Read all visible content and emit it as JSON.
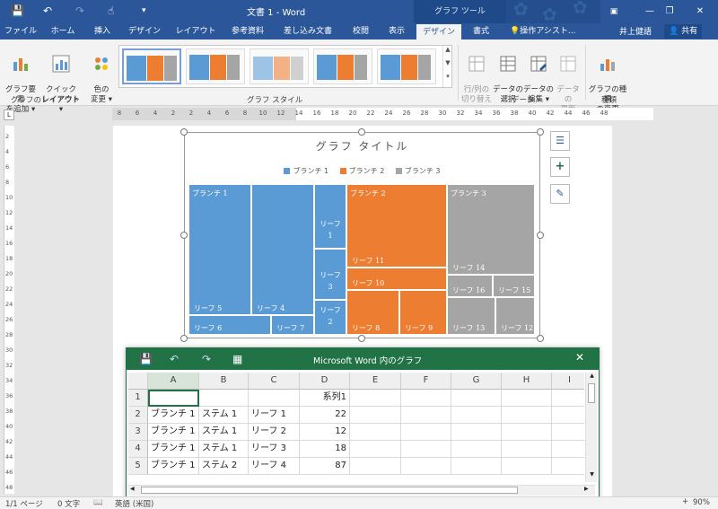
{
  "window": {
    "title": "文書 1 - Word",
    "context_tab_group": "グラフ ツール",
    "minimize": "—",
    "restore": "❐",
    "close": "✕",
    "ribbon_options": "▣"
  },
  "quick_access": {
    "save": "💾",
    "undo": "↶",
    "redo": "↷",
    "touch": "☝",
    "customize": "▾"
  },
  "tabs": [
    {
      "label": "ファイル",
      "active": false
    },
    {
      "label": "ホーム",
      "active": false
    },
    {
      "label": "挿入",
      "active": false
    },
    {
      "label": "デザイン",
      "active": false
    },
    {
      "label": "レイアウト",
      "active": false
    },
    {
      "label": "参考資料",
      "active": false
    },
    {
      "label": "差し込み文書",
      "active": false
    },
    {
      "label": "校閲",
      "active": false
    },
    {
      "label": "表示",
      "active": false
    },
    {
      "label": "デザイン",
      "active": true
    },
    {
      "label": "書式",
      "active": false
    }
  ],
  "tell_me": "操作アシスト...",
  "user": "井上健語",
  "share": "共有",
  "ribbon": {
    "add_element": "グラフ要素\nを追加 ▾",
    "quick_layout": "クイック\nレイアウト ▾",
    "change_colors": "色の\n変更 ▾",
    "switch_row_col": "行/列の\n切り替え",
    "select_data": "データの\n選択",
    "edit_data": "データの\n編集 ▾",
    "refresh_data": "データの\n更新",
    "change_type": "グラフの種類\nの変更",
    "group_layout": "グラフのレイアウト",
    "group_styles": "グラフ スタイル",
    "group_data": "データ",
    "group_type": "種類"
  },
  "ruler": {
    "corner": "L",
    "labels": [
      "8",
      "6",
      "4",
      "2",
      "2",
      "4",
      "6",
      "8",
      "10",
      "12",
      "14",
      "16",
      "18",
      "20",
      "22",
      "24",
      "26",
      "28",
      "30",
      "32",
      "34",
      "36",
      "38",
      "40",
      "42",
      "44",
      "46",
      "48"
    ],
    "vlabels": [
      "2",
      "4",
      "6",
      "8",
      "10",
      "12",
      "14",
      "16",
      "18",
      "20",
      "22",
      "24",
      "26",
      "28",
      "30",
      "32",
      "34",
      "36",
      "38",
      "40",
      "42",
      "44",
      "46",
      "48"
    ]
  },
  "chart_data": {
    "type": "treemap",
    "title": "グラフ タイトル",
    "legend": [
      "ブランチ 1",
      "ブランチ 2",
      "ブランチ 3"
    ],
    "colors": {
      "ブランチ 1": "#5b9bd5",
      "ブランチ 2": "#ed7d31",
      "ブランチ 3": "#a5a5a5"
    },
    "legend_position": "top",
    "series_name": "系列1",
    "categories": [
      "ブランチ",
      "ステム",
      "リーフ"
    ],
    "data": [
      {
        "branch": "ブランチ 1",
        "stem": "ステム 1",
        "leaf": "リーフ 1",
        "value": 22
      },
      {
        "branch": "ブランチ 1",
        "stem": "ステム 1",
        "leaf": "リーフ 2",
        "value": 12
      },
      {
        "branch": "ブランチ 1",
        "stem": "ステム 1",
        "leaf": "リーフ 3",
        "value": 18
      },
      {
        "branch": "ブランチ 1",
        "stem": "ステム 2",
        "leaf": "リーフ 4",
        "value": 87
      },
      {
        "branch": "ブランチ 1",
        "stem": "ステム 2",
        "leaf": "リーフ 5",
        "value": 88
      },
      {
        "branch": "ブランチ 1",
        "stem": "ステム 2",
        "leaf": "リーフ 6",
        "value": 25
      },
      {
        "branch": "ブランチ 1",
        "stem": "ステム 2",
        "leaf": "リーフ 7",
        "value": 15
      },
      {
        "branch": "ブランチ 2",
        "stem": "",
        "leaf": "リーフ 8",
        "value": 24
      },
      {
        "branch": "ブランチ 2",
        "stem": "",
        "leaf": "リーフ 9",
        "value": 22
      },
      {
        "branch": "ブランチ 2",
        "stem": "",
        "leaf": "リーフ 10",
        "value": 25
      },
      {
        "branch": "ブランチ 2",
        "stem": "",
        "leaf": "リーフ 11",
        "value": 82
      },
      {
        "branch": "ブランチ 3",
        "stem": "",
        "leaf": "リーフ 12",
        "value": 16
      },
      {
        "branch": "ブランチ 3",
        "stem": "",
        "leaf": "リーフ 13",
        "value": 19
      },
      {
        "branch": "ブランチ 3",
        "stem": "",
        "leaf": "リーフ 14",
        "value": 86
      },
      {
        "branch": "ブランチ 3",
        "stem": "",
        "leaf": "リーフ 15",
        "value": 23
      },
      {
        "branch": "ブランチ 3",
        "stem": "",
        "leaf": "リーフ 16",
        "value": 21
      }
    ]
  },
  "excel": {
    "title": "Microsoft Word 内のグラフ",
    "close": "✕",
    "columns": [
      "A",
      "B",
      "C",
      "D",
      "E",
      "F",
      "G",
      "H",
      "I"
    ],
    "rows": [
      {
        "num": "1",
        "cells": [
          "",
          "",
          "",
          "系列1"
        ]
      },
      {
        "num": "2",
        "cells": [
          "ブランチ 1",
          "ステム 1",
          "リーフ 1",
          "22"
        ]
      },
      {
        "num": "3",
        "cells": [
          "ブランチ 1",
          "ステム 1",
          "リーフ 2",
          "12"
        ]
      },
      {
        "num": "4",
        "cells": [
          "ブランチ 1",
          "ステム 1",
          "リーフ 3",
          "18"
        ]
      },
      {
        "num": "5",
        "cells": [
          "ブランチ 1",
          "ステム 2",
          "リーフ 4",
          "87"
        ]
      }
    ]
  },
  "status": {
    "page": "1/1 ページ",
    "words": "0 文字",
    "language": "英語 (米国)",
    "zoom": "90%",
    "zoom_in": "+"
  }
}
